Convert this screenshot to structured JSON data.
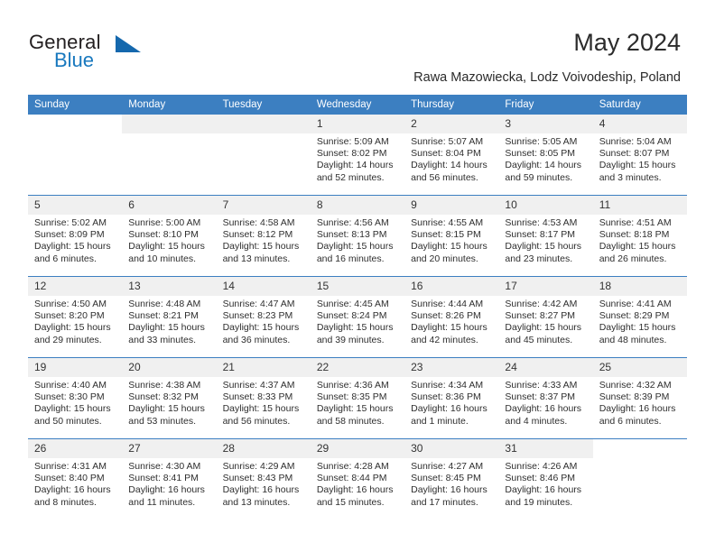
{
  "brand": {
    "name_top": "General",
    "name_bottom": "Blue",
    "accent_color": "#1568ad",
    "text_color": "#231f20"
  },
  "header": {
    "title": "May 2024",
    "subtitle": "Rawa Mazowiecka, Lodz Voivodeship, Poland"
  },
  "calendar": {
    "header_bg": "#3c7fc1",
    "daynum_bg": "#f0f0f0",
    "weekday_headers": [
      "Sunday",
      "Monday",
      "Tuesday",
      "Wednesday",
      "Thursday",
      "Friday",
      "Saturday"
    ],
    "weeks": [
      [
        {
          "day": "",
          "blank": true,
          "empty": true,
          "sunrise": "",
          "sunset": "",
          "daylight": "",
          "daylight2": ""
        },
        {
          "day": "",
          "blank": false,
          "empty": true,
          "sunrise": "",
          "sunset": "",
          "daylight": "",
          "daylight2": ""
        },
        {
          "day": "",
          "blank": false,
          "empty": true,
          "sunrise": "",
          "sunset": "",
          "daylight": "",
          "daylight2": ""
        },
        {
          "day": "1",
          "blank": false,
          "empty": false,
          "sunrise": "Sunrise: 5:09 AM",
          "sunset": "Sunset: 8:02 PM",
          "daylight": "Daylight: 14 hours",
          "daylight2": "and 52 minutes."
        },
        {
          "day": "2",
          "blank": false,
          "empty": false,
          "sunrise": "Sunrise: 5:07 AM",
          "sunset": "Sunset: 8:04 PM",
          "daylight": "Daylight: 14 hours",
          "daylight2": "and 56 minutes."
        },
        {
          "day": "3",
          "blank": false,
          "empty": false,
          "sunrise": "Sunrise: 5:05 AM",
          "sunset": "Sunset: 8:05 PM",
          "daylight": "Daylight: 14 hours",
          "daylight2": "and 59 minutes."
        },
        {
          "day": "4",
          "blank": false,
          "empty": false,
          "sunrise": "Sunrise: 5:04 AM",
          "sunset": "Sunset: 8:07 PM",
          "daylight": "Daylight: 15 hours",
          "daylight2": "and 3 minutes."
        }
      ],
      [
        {
          "day": "5",
          "blank": false,
          "empty": false,
          "sunrise": "Sunrise: 5:02 AM",
          "sunset": "Sunset: 8:09 PM",
          "daylight": "Daylight: 15 hours",
          "daylight2": "and 6 minutes."
        },
        {
          "day": "6",
          "blank": false,
          "empty": false,
          "sunrise": "Sunrise: 5:00 AM",
          "sunset": "Sunset: 8:10 PM",
          "daylight": "Daylight: 15 hours",
          "daylight2": "and 10 minutes."
        },
        {
          "day": "7",
          "blank": false,
          "empty": false,
          "sunrise": "Sunrise: 4:58 AM",
          "sunset": "Sunset: 8:12 PM",
          "daylight": "Daylight: 15 hours",
          "daylight2": "and 13 minutes."
        },
        {
          "day": "8",
          "blank": false,
          "empty": false,
          "sunrise": "Sunrise: 4:56 AM",
          "sunset": "Sunset: 8:13 PM",
          "daylight": "Daylight: 15 hours",
          "daylight2": "and 16 minutes."
        },
        {
          "day": "9",
          "blank": false,
          "empty": false,
          "sunrise": "Sunrise: 4:55 AM",
          "sunset": "Sunset: 8:15 PM",
          "daylight": "Daylight: 15 hours",
          "daylight2": "and 20 minutes."
        },
        {
          "day": "10",
          "blank": false,
          "empty": false,
          "sunrise": "Sunrise: 4:53 AM",
          "sunset": "Sunset: 8:17 PM",
          "daylight": "Daylight: 15 hours",
          "daylight2": "and 23 minutes."
        },
        {
          "day": "11",
          "blank": false,
          "empty": false,
          "sunrise": "Sunrise: 4:51 AM",
          "sunset": "Sunset: 8:18 PM",
          "daylight": "Daylight: 15 hours",
          "daylight2": "and 26 minutes."
        }
      ],
      [
        {
          "day": "12",
          "blank": false,
          "empty": false,
          "sunrise": "Sunrise: 4:50 AM",
          "sunset": "Sunset: 8:20 PM",
          "daylight": "Daylight: 15 hours",
          "daylight2": "and 29 minutes."
        },
        {
          "day": "13",
          "blank": false,
          "empty": false,
          "sunrise": "Sunrise: 4:48 AM",
          "sunset": "Sunset: 8:21 PM",
          "daylight": "Daylight: 15 hours",
          "daylight2": "and 33 minutes."
        },
        {
          "day": "14",
          "blank": false,
          "empty": false,
          "sunrise": "Sunrise: 4:47 AM",
          "sunset": "Sunset: 8:23 PM",
          "daylight": "Daylight: 15 hours",
          "daylight2": "and 36 minutes."
        },
        {
          "day": "15",
          "blank": false,
          "empty": false,
          "sunrise": "Sunrise: 4:45 AM",
          "sunset": "Sunset: 8:24 PM",
          "daylight": "Daylight: 15 hours",
          "daylight2": "and 39 minutes."
        },
        {
          "day": "16",
          "blank": false,
          "empty": false,
          "sunrise": "Sunrise: 4:44 AM",
          "sunset": "Sunset: 8:26 PM",
          "daylight": "Daylight: 15 hours",
          "daylight2": "and 42 minutes."
        },
        {
          "day": "17",
          "blank": false,
          "empty": false,
          "sunrise": "Sunrise: 4:42 AM",
          "sunset": "Sunset: 8:27 PM",
          "daylight": "Daylight: 15 hours",
          "daylight2": "and 45 minutes."
        },
        {
          "day": "18",
          "blank": false,
          "empty": false,
          "sunrise": "Sunrise: 4:41 AM",
          "sunset": "Sunset: 8:29 PM",
          "daylight": "Daylight: 15 hours",
          "daylight2": "and 48 minutes."
        }
      ],
      [
        {
          "day": "19",
          "blank": false,
          "empty": false,
          "sunrise": "Sunrise: 4:40 AM",
          "sunset": "Sunset: 8:30 PM",
          "daylight": "Daylight: 15 hours",
          "daylight2": "and 50 minutes."
        },
        {
          "day": "20",
          "blank": false,
          "empty": false,
          "sunrise": "Sunrise: 4:38 AM",
          "sunset": "Sunset: 8:32 PM",
          "daylight": "Daylight: 15 hours",
          "daylight2": "and 53 minutes."
        },
        {
          "day": "21",
          "blank": false,
          "empty": false,
          "sunrise": "Sunrise: 4:37 AM",
          "sunset": "Sunset: 8:33 PM",
          "daylight": "Daylight: 15 hours",
          "daylight2": "and 56 minutes."
        },
        {
          "day": "22",
          "blank": false,
          "empty": false,
          "sunrise": "Sunrise: 4:36 AM",
          "sunset": "Sunset: 8:35 PM",
          "daylight": "Daylight: 15 hours",
          "daylight2": "and 58 minutes."
        },
        {
          "day": "23",
          "blank": false,
          "empty": false,
          "sunrise": "Sunrise: 4:34 AM",
          "sunset": "Sunset: 8:36 PM",
          "daylight": "Daylight: 16 hours",
          "daylight2": "and 1 minute."
        },
        {
          "day": "24",
          "blank": false,
          "empty": false,
          "sunrise": "Sunrise: 4:33 AM",
          "sunset": "Sunset: 8:37 PM",
          "daylight": "Daylight: 16 hours",
          "daylight2": "and 4 minutes."
        },
        {
          "day": "25",
          "blank": false,
          "empty": false,
          "sunrise": "Sunrise: 4:32 AM",
          "sunset": "Sunset: 8:39 PM",
          "daylight": "Daylight: 16 hours",
          "daylight2": "and 6 minutes."
        }
      ],
      [
        {
          "day": "26",
          "blank": false,
          "empty": false,
          "sunrise": "Sunrise: 4:31 AM",
          "sunset": "Sunset: 8:40 PM",
          "daylight": "Daylight: 16 hours",
          "daylight2": "and 8 minutes."
        },
        {
          "day": "27",
          "blank": false,
          "empty": false,
          "sunrise": "Sunrise: 4:30 AM",
          "sunset": "Sunset: 8:41 PM",
          "daylight": "Daylight: 16 hours",
          "daylight2": "and 11 minutes."
        },
        {
          "day": "28",
          "blank": false,
          "empty": false,
          "sunrise": "Sunrise: 4:29 AM",
          "sunset": "Sunset: 8:43 PM",
          "daylight": "Daylight: 16 hours",
          "daylight2": "and 13 minutes."
        },
        {
          "day": "29",
          "blank": false,
          "empty": false,
          "sunrise": "Sunrise: 4:28 AM",
          "sunset": "Sunset: 8:44 PM",
          "daylight": "Daylight: 16 hours",
          "daylight2": "and 15 minutes."
        },
        {
          "day": "30",
          "blank": false,
          "empty": false,
          "sunrise": "Sunrise: 4:27 AM",
          "sunset": "Sunset: 8:45 PM",
          "daylight": "Daylight: 16 hours",
          "daylight2": "and 17 minutes."
        },
        {
          "day": "31",
          "blank": false,
          "empty": false,
          "sunrise": "Sunrise: 4:26 AM",
          "sunset": "Sunset: 8:46 PM",
          "daylight": "Daylight: 16 hours",
          "daylight2": "and 19 minutes."
        },
        {
          "day": "",
          "blank": true,
          "empty": true,
          "sunrise": "",
          "sunset": "",
          "daylight": "",
          "daylight2": ""
        }
      ]
    ]
  }
}
